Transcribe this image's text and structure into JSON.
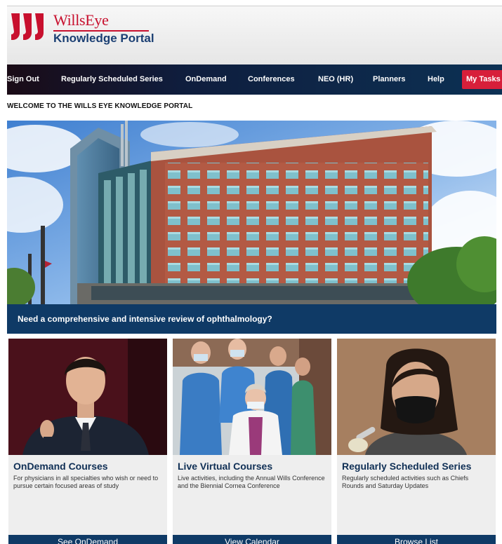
{
  "brand": {
    "name": "WillsEye",
    "subtitle": "Knowledge Portal",
    "logo_icon": "triple-bar-logo-icon",
    "brand_color": "#c8102e"
  },
  "nav": {
    "items": [
      {
        "label": "Sign Out"
      },
      {
        "label": "Regularly Scheduled Series"
      },
      {
        "label": "OnDemand"
      },
      {
        "label": "Conferences"
      },
      {
        "label": "NEO (HR)"
      },
      {
        "label": "Planners"
      },
      {
        "label": "Help"
      },
      {
        "label": "My Tasks"
      }
    ],
    "highlight_color": "#d71f3a"
  },
  "welcome": "WELCOME TO THE WILLS EYE KNOWLEDGE PORTAL",
  "hero": {
    "banner_text": "Need a comprehensive and intensive review of ophthalmology?",
    "banner_color": "#0f3a66"
  },
  "cards": [
    {
      "title": "OnDemand Courses",
      "description": "For physicians in all specialties who wish or need to pursue certain focused areas of study",
      "button": "See OnDemand"
    },
    {
      "title": "Live Virtual Courses",
      "description": "Live activities, including the Annual Wills Conference and the Biennial Cornea Conference",
      "button": "View Calendar"
    },
    {
      "title": "Regularly Scheduled Series",
      "description": "Regularly scheduled activities such as Chiefs Rounds and Saturday Updates",
      "button": "Browse List"
    }
  ]
}
